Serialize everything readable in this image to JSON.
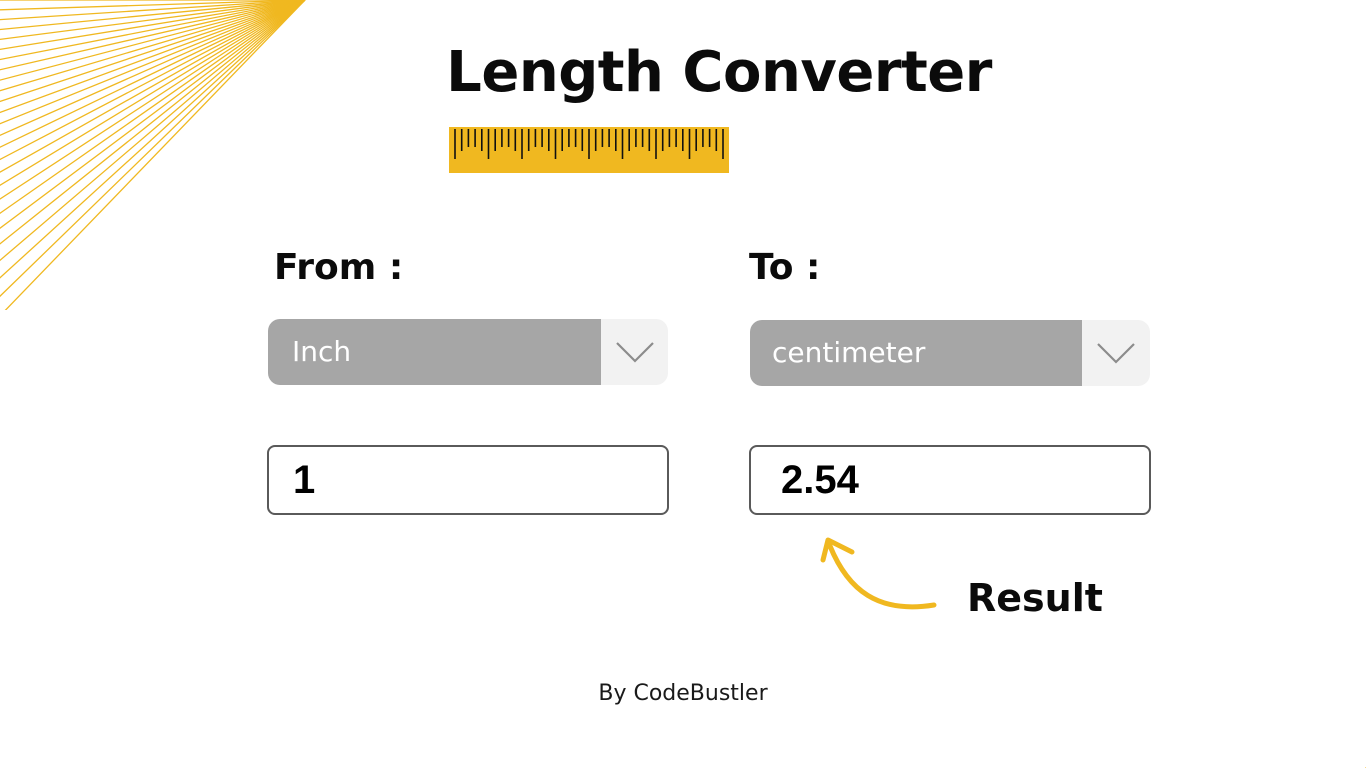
{
  "title": "Length Converter",
  "from": {
    "label": "From :",
    "unit": "Inch",
    "value": "1"
  },
  "to": {
    "label": "To :",
    "unit": "centimeter",
    "value": "2.54"
  },
  "result_label": "Result",
  "credit": "By CodeBustler",
  "icons": {
    "ruler": "ruler-icon",
    "dropdown": "chevron-down-icon",
    "pointer": "curved-arrow-icon",
    "decoration": "sunburst-lines"
  },
  "colors": {
    "accent": "#f0b820",
    "select_bg": "#a6a6a6",
    "select_arrow_bg": "#f2f2f2",
    "border": "#5a5a5a",
    "text": "#0b0b0b"
  }
}
